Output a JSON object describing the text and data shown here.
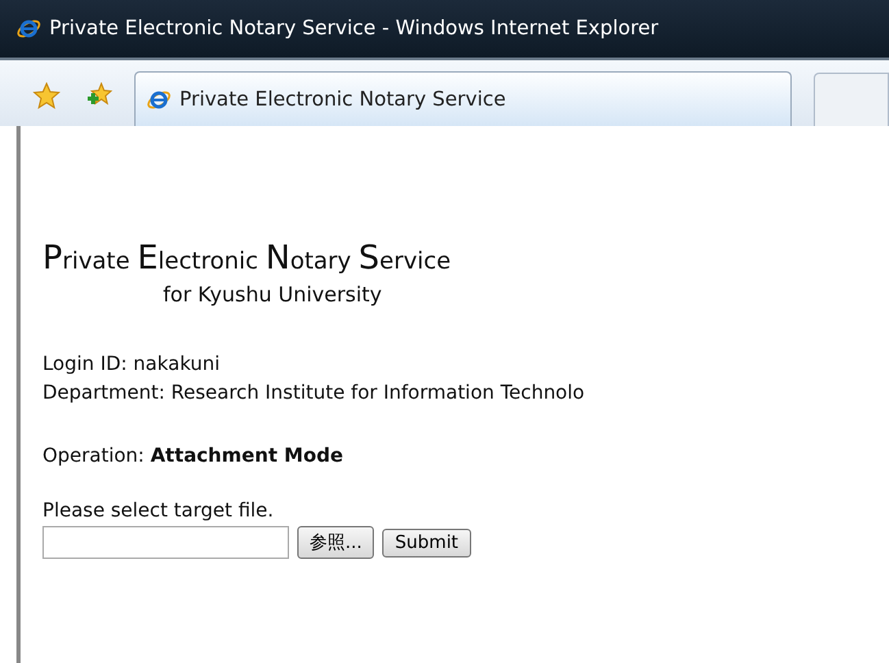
{
  "window": {
    "title": "Private Electronic Notary Service - Windows Internet Explorer"
  },
  "tabs": [
    {
      "label": "Private Electronic Notary Service",
      "selected": true
    }
  ],
  "page": {
    "heading_words": [
      "Private",
      "Electronic",
      "Notary",
      "Service"
    ],
    "subtitle": "for Kyushu University",
    "login": "Login ID: nakakuni",
    "department": "Department: Research Institute for Information Technolo",
    "operation_label": "Operation:",
    "operation_value": "Attachment Mode",
    "prompt": "Please select target file.",
    "browse_button": "参照...",
    "submit_button": "Submit"
  }
}
